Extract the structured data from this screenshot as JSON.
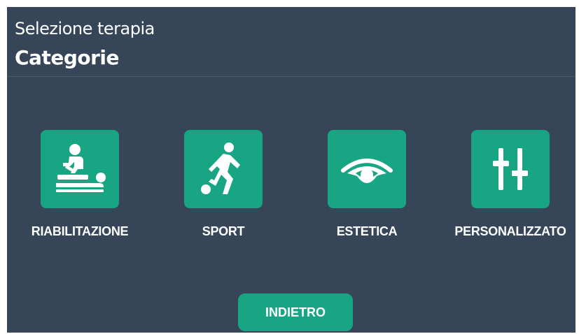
{
  "header": {
    "subtitle": "Selezione terapia",
    "title": "Categorie"
  },
  "categories": [
    {
      "label": "RIABILITAZIONE",
      "icon": "massage-therapy-icon"
    },
    {
      "label": "SPORT",
      "icon": "soccer-player-icon"
    },
    {
      "label": "ESTETICA",
      "icon": "eye-icon"
    },
    {
      "label": "PERSONALIZZATO",
      "icon": "sliders-icon"
    }
  ],
  "footer": {
    "back_label": "INDIETRO"
  },
  "colors": {
    "background": "#364658",
    "accent": "#18a583",
    "text": "#ffffff"
  }
}
